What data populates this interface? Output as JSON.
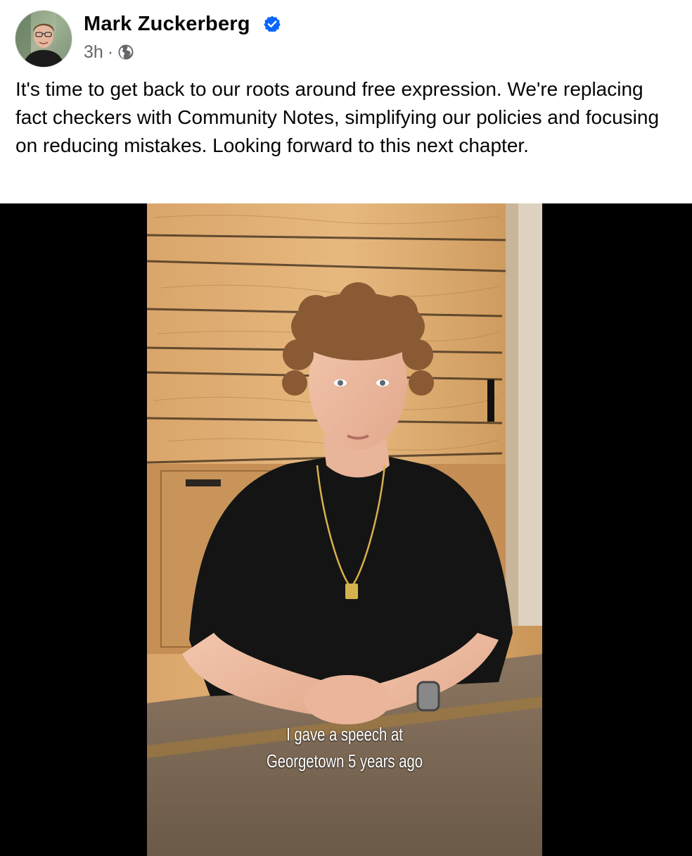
{
  "post": {
    "author": "Mark Zuckerberg",
    "timestamp": "3h",
    "separator": "·",
    "audience_icon": "globe-icon",
    "verified_icon": "verified-badge-icon",
    "text": "It's time to get back to our roots around free expression. We're replacing fact checkers with Community Notes, simplifying our policies and focusing on reducing mistakes. Looking forward to this next chapter."
  },
  "video": {
    "caption_line1": "I gave a speech at",
    "caption_line2": "Georgetown 5 years ago"
  },
  "colors": {
    "verified_blue": "#0866ff",
    "meta_gray": "#65676b",
    "text": "#050505",
    "video_letterbox": "#000000"
  }
}
